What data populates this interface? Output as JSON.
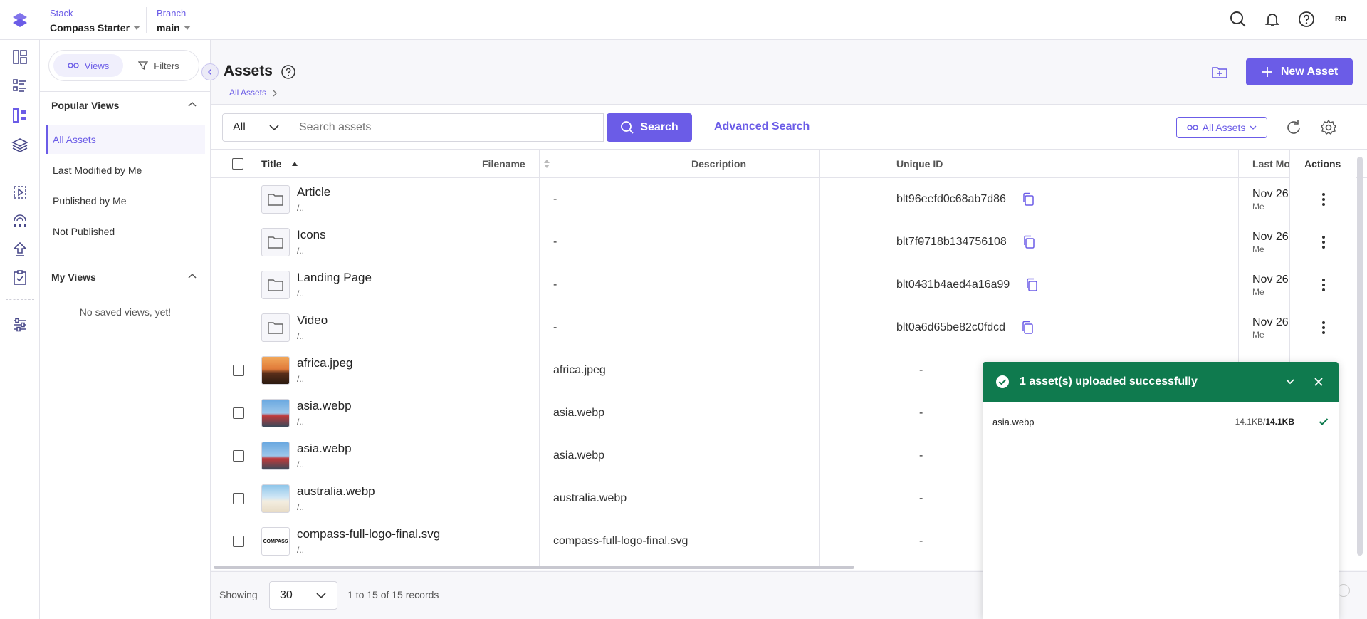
{
  "topbar": {
    "stack_label": "Stack",
    "stack_value": "Compass Starter",
    "branch_label": "Branch",
    "branch_value": "main",
    "avatar_initials": "RD"
  },
  "sidepanel": {
    "views_label": "Views",
    "filters_label": "Filters",
    "popular_title": "Popular Views",
    "popular_items": [
      "All Assets",
      "Last Modified by Me",
      "Published by Me",
      "Not Published"
    ],
    "my_views_title": "My Views",
    "my_views_empty": "No saved views, yet!"
  },
  "main": {
    "title": "Assets",
    "breadcrumb": "All Assets",
    "new_asset_label": "New Asset"
  },
  "toolbar": {
    "type_value": "All",
    "search_placeholder": "Search assets",
    "search_label": "Search",
    "advanced_search_label": "Advanced Search",
    "scope_label": "All Assets"
  },
  "table": {
    "headers": {
      "title": "Title",
      "filename": "Filename",
      "description": "Description",
      "uid": "Unique ID",
      "modified": "Last Mo",
      "actions": "Actions"
    },
    "rows": [
      {
        "title": "Article",
        "path": "/..",
        "filename": "-",
        "description": "-",
        "uid": "blt96eefd0c68ab7d86",
        "date": "Nov 26",
        "by": "Me",
        "kind": "folder"
      },
      {
        "title": "Icons",
        "path": "/..",
        "filename": "-",
        "description": "-",
        "uid": "blt7f0718b134756108",
        "date": "Nov 26",
        "by": "Me",
        "kind": "folder"
      },
      {
        "title": "Landing Page",
        "path": "/..",
        "filename": "-",
        "description": "-",
        "uid": "blt0431b4aed4a16a99",
        "date": "Nov 26",
        "by": "Me",
        "kind": "folder"
      },
      {
        "title": "Video",
        "path": "/..",
        "filename": "-",
        "description": "-",
        "uid": "blt0a6d65be82c0fdcd",
        "date": "Nov 26",
        "by": "Me",
        "kind": "folder"
      },
      {
        "title": "africa.jpeg",
        "path": "/..",
        "filename": "africa.jpeg",
        "description": "-",
        "kind": "image-africa"
      },
      {
        "title": "asia.webp",
        "path": "/..",
        "filename": "asia.webp",
        "description": "-",
        "kind": "image-asia"
      },
      {
        "title": "asia.webp",
        "path": "/..",
        "filename": "asia.webp",
        "description": "-",
        "kind": "image-asia"
      },
      {
        "title": "australia.webp",
        "path": "/..",
        "filename": "australia.webp",
        "description": "-",
        "kind": "image-australia"
      },
      {
        "title": "compass-full-logo-final.svg",
        "path": "/..",
        "filename": "compass-full-logo-final.svg",
        "description": "-",
        "kind": "image-logo",
        "logo_text": "COMPASS"
      }
    ]
  },
  "footer": {
    "showing_label": "Showing",
    "per_page": "30",
    "records": "1 to 15 of 15 records"
  },
  "toast": {
    "message": "1 asset(s) uploaded successfully",
    "file_name": "asia.webp",
    "size_done": "14.1KB/",
    "size_total": "14.1KB"
  },
  "colors": {
    "accent": "#6b5ce7",
    "success": "#0f7a4e"
  }
}
